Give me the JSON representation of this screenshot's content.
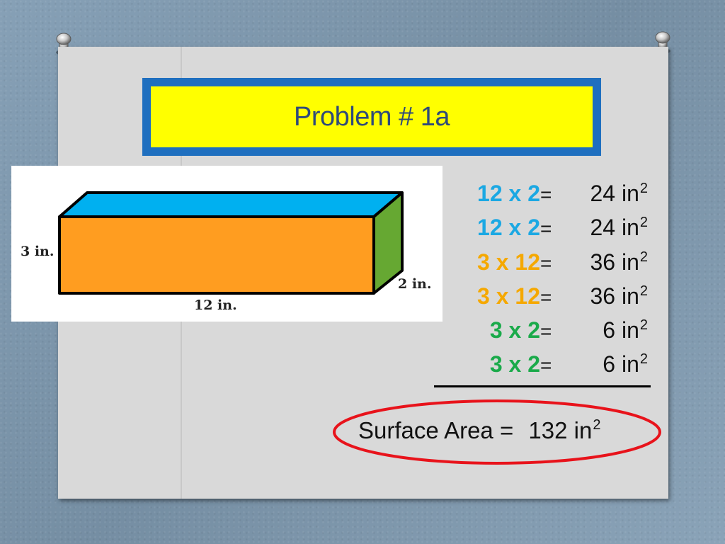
{
  "slide": {
    "title": "Problem # 1a",
    "colors": {
      "background": "#7f98ad",
      "card": "#d9d9d9",
      "title_border": "#1f6fbf",
      "title_fill": "#ffff00",
      "title_text": "#2e4a7a",
      "cyan": "#1ba8e3",
      "orange": "#f5a800",
      "green": "#1aaa4a",
      "ellipse": "#e8131b"
    }
  },
  "figure": {
    "labels": {
      "height": "3 in.",
      "depth": "2 in.",
      "length": "12 in."
    },
    "faces": {
      "top": "#00b0f0",
      "front": "#ff9d20",
      "side": "#66a832"
    }
  },
  "calculations": [
    {
      "expression": "12 x 2",
      "color": "#1ba8e3",
      "equals": "=",
      "value": "24 in",
      "exponent": "2"
    },
    {
      "expression": "12 x 2",
      "color": "#1ba8e3",
      "equals": "=",
      "value": "24 in",
      "exponent": "2"
    },
    {
      "expression": "3 x 12",
      "color": "#f5a800",
      "equals": "=",
      "value": "36 in",
      "exponent": "2"
    },
    {
      "expression": "3 x 12",
      "color": "#f5a800",
      "equals": "=",
      "value": "36 in",
      "exponent": "2"
    },
    {
      "expression": "3 x 2",
      "color": "#1aaa4a",
      "equals": "=",
      "value": "6 in",
      "exponent": "2"
    },
    {
      "expression": "3 x 2",
      "color": "#1aaa4a",
      "equals": "=",
      "value": "6 in",
      "exponent": "2"
    }
  ],
  "result": {
    "label": "Surface Area =",
    "value": "132 in",
    "exponent": "2"
  }
}
